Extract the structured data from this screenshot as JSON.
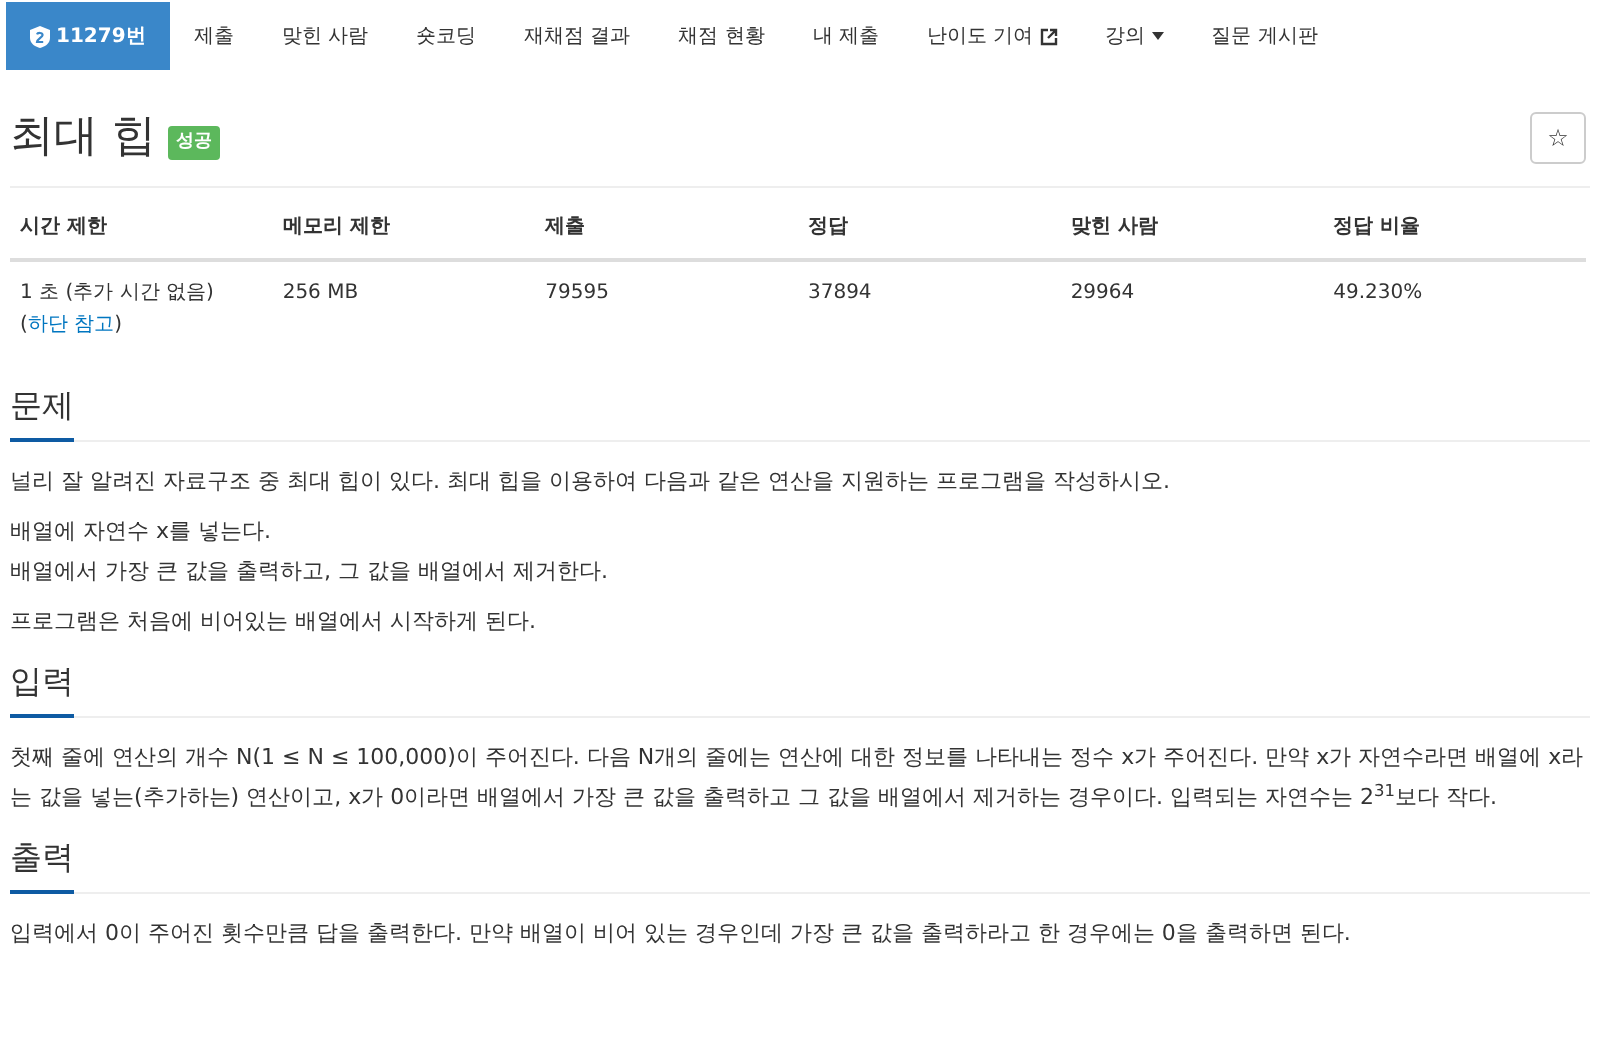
{
  "nav": [
    {
      "label": "11279번",
      "selected": true,
      "kind": "problem"
    },
    {
      "label": "제출",
      "selected": false,
      "kind": "plain"
    },
    {
      "label": "맞힌 사람",
      "selected": false,
      "kind": "plain"
    },
    {
      "label": "숏코딩",
      "selected": false,
      "kind": "plain"
    },
    {
      "label": "재채점 결과",
      "selected": false,
      "kind": "plain"
    },
    {
      "label": "채점 현황",
      "selected": false,
      "kind": "plain"
    },
    {
      "label": "내 제출",
      "selected": false,
      "kind": "plain"
    },
    {
      "label": "난이도 기여",
      "selected": false,
      "kind": "external"
    },
    {
      "label": "강의",
      "selected": false,
      "kind": "dropdown"
    },
    {
      "label": "질문 게시판",
      "selected": false,
      "kind": "plain"
    }
  ],
  "title": "최대 힙",
  "badge": "성공",
  "star_button": "☆",
  "table": {
    "columns": [
      "시간 제한",
      "메모리 제한",
      "제출",
      "정답",
      "맞힌 사람",
      "정답 비율"
    ],
    "row": [
      {
        "text": "1 초 (추가 시간 없음) (",
        "link": "하단 참고",
        "suffix": ")"
      },
      {
        "text": "256 MB"
      },
      {
        "text": "79595"
      },
      {
        "text": "37894"
      },
      {
        "text": "29964"
      },
      {
        "text": "49.230%"
      }
    ]
  },
  "sections": [
    {
      "heading": "문제",
      "paragraphs": [
        "널리 잘 알려진 자료구조 중 최대 힙이 있다. 최대 힙을 이용하여 다음과 같은 연산을 지원하는 프로그램을 작성하시오.",
        "배열에 자연수 x를 넣는다.\n배열에서 가장 큰 값을 출력하고, 그 값을 배열에서 제거한다.",
        "프로그램은 처음에 비어있는 배열에서 시작하게 된다."
      ]
    },
    {
      "heading": "입력",
      "paragraphs": [
        "첫째 줄에 연산의 개수 N(1 ≤ N ≤ 100,000)이 주어진다. 다음 N개의 줄에는 연산에 대한 정보를 나타내는 정수 x가 주어진다. 만약 x가 자연수라면 배열에 x라는 값을 넣는(추가하는) 연산이고, x가 0이라면 배열에서 가장 큰 값을 출력하고 그 값을 배열에서 제거하는 경우이다. 입력되는 자연수는 2$^{31}$보다 작다."
      ]
    },
    {
      "heading": "출력",
      "paragraphs": [
        "입력에서 0이 주어진 횟수만큼 답을 출력한다. 만약 배열이 비어 있는 경우인데 가장 큰 값을 출력하라고 한 경우에는 0을 출력하면 된다."
      ]
    }
  ]
}
